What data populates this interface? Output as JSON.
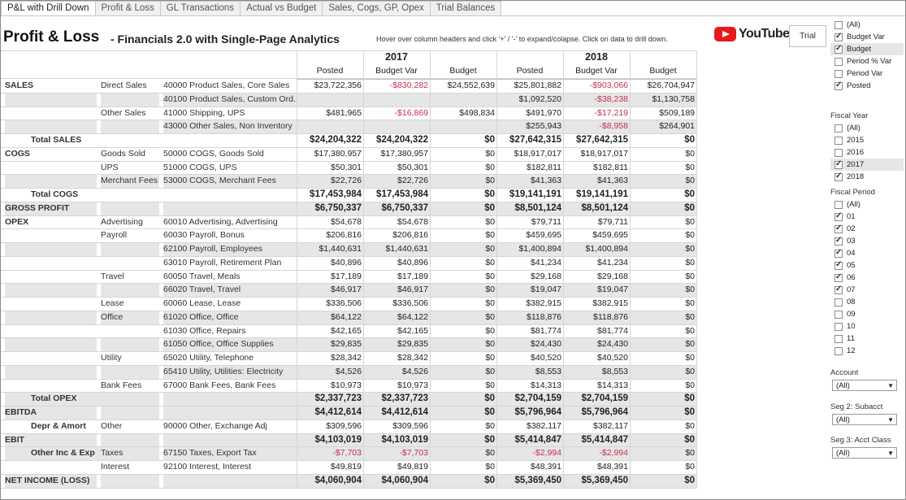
{
  "tabs": [
    "P&L with Drill Down",
    "Profit & Loss",
    "GL Transactions",
    "Actual vs Budget",
    "Sales, Cogs, GP, Opex",
    "Trial Balances"
  ],
  "header": {
    "title": "Profit & Loss",
    "subtitle": "-  Financials 2.0 with Single-Page Analytics",
    "hint": "Hover over column headers and click '+' / '-'  to expand/colapse. Click on data to drill down.",
    "youtube": "YouTube",
    "trial": "Trial"
  },
  "table": {
    "years": [
      "2017",
      "2018"
    ],
    "columns": [
      "Posted",
      "Budget Var",
      "Budget",
      "Posted",
      "Budget Var",
      "Budget"
    ],
    "rows": [
      {
        "l1": "SALES",
        "l2": "Direct Sales",
        "l3": "40000 Product Sales, Core Sales",
        "v": [
          "$23,722,356",
          "-$830,282",
          "$24,552,639",
          "$25,801,882",
          "-$903,066",
          "$26,704,947"
        ]
      },
      {
        "l1": "",
        "l2": "",
        "l3": "40100 Product Sales, Custom Ord..",
        "v": [
          "",
          "",
          "",
          "$1,092,520",
          "-$38,238",
          "$1,130,758"
        ],
        "shade": true
      },
      {
        "l1": "",
        "l2": "Other Sales",
        "l3": "41000 Shipping, UPS",
        "v": [
          "$481,965",
          "-$16,869",
          "$498,834",
          "$491,970",
          "-$17,219",
          "$509,189"
        ]
      },
      {
        "l1": "",
        "l2": "",
        "l3": "43000 Other Sales, Non Inventory",
        "v": [
          "",
          "",
          "",
          "$255,943",
          "-$8,958",
          "$264,901"
        ],
        "shade": true
      },
      {
        "l1": "Total SALES",
        "l2": "",
        "l3": "",
        "v": [
          "$24,204,322",
          "$24,204,322",
          "$0",
          "$27,642,315",
          "$27,642,315",
          "$0"
        ],
        "total": true,
        "indent": true
      },
      {
        "l1": "COGS",
        "l2": "Goods Sold",
        "l3": "50000 COGS, Goods Sold",
        "v": [
          "$17,380,957",
          "$17,380,957",
          "$0",
          "$18,917,017",
          "$18,917,017",
          "$0"
        ]
      },
      {
        "l1": "",
        "l2": "UPS",
        "l3": "51000 COGS, UPS",
        "v": [
          "$50,301",
          "$50,301",
          "$0",
          "$182,811",
          "$182,811",
          "$0"
        ]
      },
      {
        "l1": "",
        "l2": "Merchant Fees",
        "l3": "53000 COGS, Merchant Fees",
        "v": [
          "$22,726",
          "$22,726",
          "$0",
          "$41,363",
          "$41,363",
          "$0"
        ],
        "shade": true
      },
      {
        "l1": "Total COGS",
        "l2": "",
        "l3": "",
        "v": [
          "$17,453,984",
          "$17,453,984",
          "$0",
          "$19,141,191",
          "$19,141,191",
          "$0"
        ],
        "total": true,
        "indent": true
      },
      {
        "l1": "GROSS PROFIT",
        "l2": "",
        "l3": "",
        "v": [
          "$6,750,337",
          "$6,750,337",
          "$0",
          "$8,501,124",
          "$8,501,124",
          "$0"
        ],
        "total": true,
        "shade": true
      },
      {
        "l1": "OPEX",
        "l2": "Advertising",
        "l3": "60010 Advertising, Advertising",
        "v": [
          "$54,678",
          "$54,678",
          "$0",
          "$79,711",
          "$79,711",
          "$0"
        ]
      },
      {
        "l1": "",
        "l2": "Payroll",
        "l3": "60030 Payroll, Bonus",
        "v": [
          "$206,816",
          "$206,816",
          "$0",
          "$459,695",
          "$459,695",
          "$0"
        ]
      },
      {
        "l1": "",
        "l2": "",
        "l3": "62100 Payroll, Employees",
        "v": [
          "$1,440,631",
          "$1,440,631",
          "$0",
          "$1,400,894",
          "$1,400,894",
          "$0"
        ],
        "shade": true
      },
      {
        "l1": "",
        "l2": "",
        "l3": "63010 Payroll, Retirement Plan",
        "v": [
          "$40,896",
          "$40,896",
          "$0",
          "$41,234",
          "$41,234",
          "$0"
        ]
      },
      {
        "l1": "",
        "l2": "Travel",
        "l3": "60050 Travel, Meals",
        "v": [
          "$17,189",
          "$17,189",
          "$0",
          "$29,168",
          "$29,168",
          "$0"
        ]
      },
      {
        "l1": "",
        "l2": "",
        "l3": "66020 Travel, Travel",
        "v": [
          "$46,917",
          "$46,917",
          "$0",
          "$19,047",
          "$19,047",
          "$0"
        ],
        "shade": true
      },
      {
        "l1": "",
        "l2": "Lease",
        "l3": "60060 Lease, Lease",
        "v": [
          "$336,506",
          "$336,506",
          "$0",
          "$382,915",
          "$382,915",
          "$0"
        ]
      },
      {
        "l1": "",
        "l2": "Office",
        "l3": "61020 Office, Office",
        "v": [
          "$64,122",
          "$64,122",
          "$0",
          "$118,876",
          "$118,876",
          "$0"
        ],
        "shade": true
      },
      {
        "l1": "",
        "l2": "",
        "l3": "61030 Office, Repairs",
        "v": [
          "$42,165",
          "$42,165",
          "$0",
          "$81,774",
          "$81,774",
          "$0"
        ]
      },
      {
        "l1": "",
        "l2": "",
        "l3": "61050 Office, Office Supplies",
        "v": [
          "$29,835",
          "$29,835",
          "$0",
          "$24,430",
          "$24,430",
          "$0"
        ],
        "shade": true
      },
      {
        "l1": "",
        "l2": "Utility",
        "l3": "65020 Utility, Telephone",
        "v": [
          "$28,342",
          "$28,342",
          "$0",
          "$40,520",
          "$40,520",
          "$0"
        ]
      },
      {
        "l1": "",
        "l2": "",
        "l3": "65410 Utility, Utilities: Electricity",
        "v": [
          "$4,526",
          "$4,526",
          "$0",
          "$8,553",
          "$8,553",
          "$0"
        ],
        "shade": true
      },
      {
        "l1": "",
        "l2": "Bank Fees",
        "l3": "67000 Bank Fees, Bank Fees",
        "v": [
          "$10,973",
          "$10,973",
          "$0",
          "$14,313",
          "$14,313",
          "$0"
        ]
      },
      {
        "l1": "Total OPEX",
        "l2": "",
        "l3": "",
        "v": [
          "$2,337,723",
          "$2,337,723",
          "$0",
          "$2,704,159",
          "$2,704,159",
          "$0"
        ],
        "total": true,
        "indent": true,
        "shade": true
      },
      {
        "l1": "EBITDA",
        "l2": "",
        "l3": "",
        "v": [
          "$4,412,614",
          "$4,412,614",
          "$0",
          "$5,796,964",
          "$5,796,964",
          "$0"
        ],
        "total": true,
        "shade": true
      },
      {
        "l1": "Depr & Amort",
        "l2": "Other",
        "l3": "90000 Other, Exchange Adj",
        "v": [
          "$309,596",
          "$309,596",
          "$0",
          "$382,117",
          "$382,117",
          "$0"
        ],
        "indentsub": true
      },
      {
        "l1": "EBIT",
        "l2": "",
        "l3": "",
        "v": [
          "$4,103,019",
          "$4,103,019",
          "$0",
          "$5,414,847",
          "$5,414,847",
          "$0"
        ],
        "total": true,
        "shade": true
      },
      {
        "l1": "Other Inc & Exp",
        "l2": "Taxes",
        "l3": "67150 Taxes, Export Tax",
        "v": [
          "-$7,703",
          "-$7,703",
          "$0",
          "-$2,994",
          "-$2,994",
          "$0"
        ],
        "indentsub": true,
        "shade": true
      },
      {
        "l1": "",
        "l2": "Interest",
        "l3": "92100 Interest, Interest",
        "v": [
          "$49,819",
          "$49,819",
          "$0",
          "$48,391",
          "$48,391",
          "$0"
        ]
      },
      {
        "l1": "NET INCOME (LOSS)",
        "l2": "",
        "l3": "",
        "v": [
          "$4,060,904",
          "$4,060,904",
          "$0",
          "$5,369,450",
          "$5,369,450",
          "$0"
        ],
        "total": true,
        "shade": true
      }
    ]
  },
  "filters": {
    "measures": [
      {
        "label": "(All)",
        "checked": false
      },
      {
        "label": "Budget Var",
        "checked": true
      },
      {
        "label": "Budget",
        "checked": true,
        "hl": true
      },
      {
        "label": "Period % Var",
        "checked": false
      },
      {
        "label": "Period Var",
        "checked": false
      },
      {
        "label": "Posted",
        "checked": true
      }
    ],
    "fiscal_year_title": "Fiscal Year",
    "fiscal_year": [
      {
        "label": "(All)",
        "checked": false
      },
      {
        "label": "2015",
        "checked": false
      },
      {
        "label": "2016",
        "checked": false
      },
      {
        "label": "2017",
        "checked": true,
        "hl": true
      },
      {
        "label": "2018",
        "checked": true
      }
    ],
    "fiscal_period_title": "Fiscal Period",
    "fiscal_period": [
      {
        "label": "(All)",
        "checked": false
      },
      {
        "label": "01",
        "checked": true
      },
      {
        "label": "02",
        "checked": true
      },
      {
        "label": "03",
        "checked": true
      },
      {
        "label": "04",
        "checked": true
      },
      {
        "label": "05",
        "checked": true
      },
      {
        "label": "06",
        "checked": true
      },
      {
        "label": "07",
        "checked": true
      },
      {
        "label": "08",
        "checked": false
      },
      {
        "label": "09",
        "checked": false
      },
      {
        "label": "10",
        "checked": false
      },
      {
        "label": "11",
        "checked": false
      },
      {
        "label": "12",
        "checked": false
      }
    ],
    "dropdowns": [
      {
        "title": "Account",
        "value": "(All)"
      },
      {
        "title": "Seg 2: Subacct",
        "value": "(All)"
      },
      {
        "title": "Seg 3: Acct Class",
        "value": "(All)"
      }
    ]
  },
  "colors": {
    "negative": "#c4304f",
    "shade": "#e6e6e6",
    "youtube_red": "#e8191a"
  }
}
